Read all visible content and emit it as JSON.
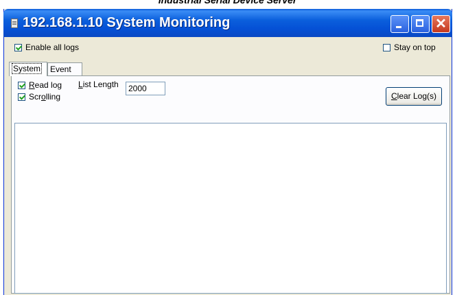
{
  "document": {
    "header": "Industrial Serial Device Server"
  },
  "window": {
    "title": "192.168.1.10 System Monitoring"
  },
  "options": {
    "enable_all_logs": {
      "label": "Enable all logs",
      "checked": true
    },
    "stay_on_top": {
      "label": "Stay on top",
      "checked": false
    }
  },
  "tabs": [
    {
      "label": "System",
      "active": true
    },
    {
      "label": "Event",
      "active": false
    }
  ],
  "system_tab": {
    "read_log": {
      "label_first": "R",
      "label_rest": "ead log",
      "checked": true
    },
    "scrolling": {
      "label_pre": "Scr",
      "label_ul": "o",
      "label_post": "lling",
      "checked": true
    },
    "list_length": {
      "label_first": "L",
      "label_rest": "ist Length",
      "value": "2000"
    },
    "clear_button": {
      "label_first": "C",
      "label_rest": "lear Log(s)"
    }
  },
  "log_entries": []
}
